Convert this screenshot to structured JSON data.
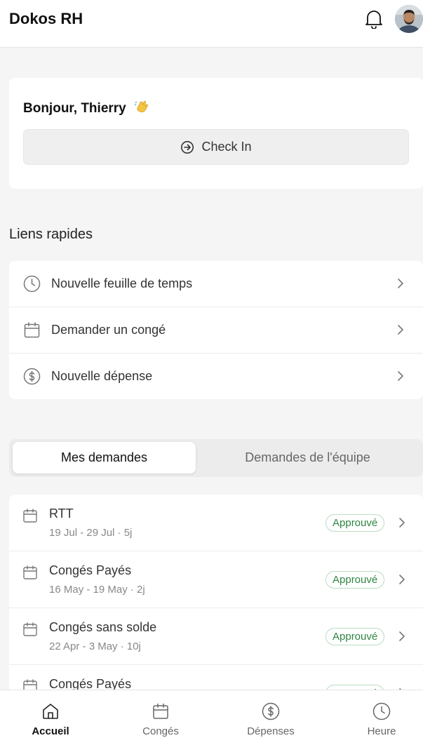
{
  "header": {
    "title": "Dokos RH",
    "bell_icon": "bell-icon",
    "avatar_icon": "user-avatar"
  },
  "greeting_card": {
    "greeting": "Bonjour, Thierry",
    "wave_icon": "waving-hand-emoji",
    "checkin_label": "Check In",
    "checkin_icon": "arrow-circle-right-icon"
  },
  "quick_links": {
    "title": "Liens rapides",
    "items": [
      {
        "label": "Nouvelle feuille de temps",
        "icon": "clock-icon"
      },
      {
        "label": "Demander un congé",
        "icon": "calendar-icon"
      },
      {
        "label": "Nouvelle dépense",
        "icon": "dollar-circle-icon"
      }
    ]
  },
  "requests_tabs": {
    "tabs": [
      {
        "label": "Mes demandes",
        "active": true
      },
      {
        "label": "Demandes de l'équipe",
        "active": false
      }
    ]
  },
  "requests": [
    {
      "title": "RTT",
      "subtitle": "19 Jul - 29 Jul · 5j",
      "status": "Approuvé"
    },
    {
      "title": "Congés Payés",
      "subtitle": "16 May - 19 May · 2j",
      "status": "Approuvé"
    },
    {
      "title": "Congés sans solde",
      "subtitle": "22 Apr - 3 May · 10j",
      "status": "Approuvé"
    },
    {
      "title": "Congés Payés",
      "subtitle": "",
      "status": "Approuvé"
    }
  ],
  "bottom_nav": {
    "items": [
      {
        "label": "Accueil",
        "icon": "home-icon",
        "active": true
      },
      {
        "label": "Congés",
        "icon": "calendar-icon",
        "active": false
      },
      {
        "label": "Dépenses",
        "icon": "dollar-circle-icon",
        "active": false
      },
      {
        "label": "Heure",
        "icon": "clock-icon",
        "active": false
      }
    ]
  },
  "colors": {
    "background": "#f5f5f5",
    "card": "#ffffff",
    "status_green": "#2e8540",
    "status_border": "#b9dcbf"
  }
}
